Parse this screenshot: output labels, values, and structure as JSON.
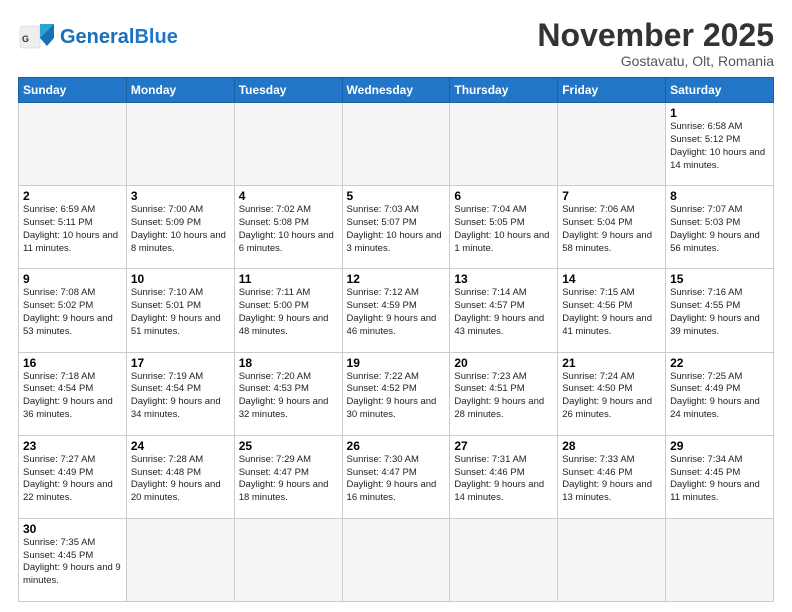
{
  "header": {
    "logo_general": "General",
    "logo_blue": "Blue",
    "month_title": "November 2025",
    "subtitle": "Gostavatu, Olt, Romania"
  },
  "weekdays": [
    "Sunday",
    "Monday",
    "Tuesday",
    "Wednesday",
    "Thursday",
    "Friday",
    "Saturday"
  ],
  "weeks": [
    [
      {
        "day": "",
        "info": "",
        "empty": true
      },
      {
        "day": "",
        "info": "",
        "empty": true
      },
      {
        "day": "",
        "info": "",
        "empty": true
      },
      {
        "day": "",
        "info": "",
        "empty": true
      },
      {
        "day": "",
        "info": "",
        "empty": true
      },
      {
        "day": "",
        "info": "",
        "empty": true
      },
      {
        "day": "1",
        "info": "Sunrise: 6:58 AM\nSunset: 5:12 PM\nDaylight: 10 hours\nand 14 minutes.",
        "empty": false
      }
    ],
    [
      {
        "day": "2",
        "info": "Sunrise: 6:59 AM\nSunset: 5:11 PM\nDaylight: 10 hours\nand 11 minutes.",
        "empty": false
      },
      {
        "day": "3",
        "info": "Sunrise: 7:00 AM\nSunset: 5:09 PM\nDaylight: 10 hours\nand 8 minutes.",
        "empty": false
      },
      {
        "day": "4",
        "info": "Sunrise: 7:02 AM\nSunset: 5:08 PM\nDaylight: 10 hours\nand 6 minutes.",
        "empty": false
      },
      {
        "day": "5",
        "info": "Sunrise: 7:03 AM\nSunset: 5:07 PM\nDaylight: 10 hours\nand 3 minutes.",
        "empty": false
      },
      {
        "day": "6",
        "info": "Sunrise: 7:04 AM\nSunset: 5:05 PM\nDaylight: 10 hours\nand 1 minute.",
        "empty": false
      },
      {
        "day": "7",
        "info": "Sunrise: 7:06 AM\nSunset: 5:04 PM\nDaylight: 9 hours\nand 58 minutes.",
        "empty": false
      },
      {
        "day": "8",
        "info": "Sunrise: 7:07 AM\nSunset: 5:03 PM\nDaylight: 9 hours\nand 56 minutes.",
        "empty": false
      }
    ],
    [
      {
        "day": "9",
        "info": "Sunrise: 7:08 AM\nSunset: 5:02 PM\nDaylight: 9 hours\nand 53 minutes.",
        "empty": false
      },
      {
        "day": "10",
        "info": "Sunrise: 7:10 AM\nSunset: 5:01 PM\nDaylight: 9 hours\nand 51 minutes.",
        "empty": false
      },
      {
        "day": "11",
        "info": "Sunrise: 7:11 AM\nSunset: 5:00 PM\nDaylight: 9 hours\nand 48 minutes.",
        "empty": false
      },
      {
        "day": "12",
        "info": "Sunrise: 7:12 AM\nSunset: 4:59 PM\nDaylight: 9 hours\nand 46 minutes.",
        "empty": false
      },
      {
        "day": "13",
        "info": "Sunrise: 7:14 AM\nSunset: 4:57 PM\nDaylight: 9 hours\nand 43 minutes.",
        "empty": false
      },
      {
        "day": "14",
        "info": "Sunrise: 7:15 AM\nSunset: 4:56 PM\nDaylight: 9 hours\nand 41 minutes.",
        "empty": false
      },
      {
        "day": "15",
        "info": "Sunrise: 7:16 AM\nSunset: 4:55 PM\nDaylight: 9 hours\nand 39 minutes.",
        "empty": false
      }
    ],
    [
      {
        "day": "16",
        "info": "Sunrise: 7:18 AM\nSunset: 4:54 PM\nDaylight: 9 hours\nand 36 minutes.",
        "empty": false
      },
      {
        "day": "17",
        "info": "Sunrise: 7:19 AM\nSunset: 4:54 PM\nDaylight: 9 hours\nand 34 minutes.",
        "empty": false
      },
      {
        "day": "18",
        "info": "Sunrise: 7:20 AM\nSunset: 4:53 PM\nDaylight: 9 hours\nand 32 minutes.",
        "empty": false
      },
      {
        "day": "19",
        "info": "Sunrise: 7:22 AM\nSunset: 4:52 PM\nDaylight: 9 hours\nand 30 minutes.",
        "empty": false
      },
      {
        "day": "20",
        "info": "Sunrise: 7:23 AM\nSunset: 4:51 PM\nDaylight: 9 hours\nand 28 minutes.",
        "empty": false
      },
      {
        "day": "21",
        "info": "Sunrise: 7:24 AM\nSunset: 4:50 PM\nDaylight: 9 hours\nand 26 minutes.",
        "empty": false
      },
      {
        "day": "22",
        "info": "Sunrise: 7:25 AM\nSunset: 4:49 PM\nDaylight: 9 hours\nand 24 minutes.",
        "empty": false
      }
    ],
    [
      {
        "day": "23",
        "info": "Sunrise: 7:27 AM\nSunset: 4:49 PM\nDaylight: 9 hours\nand 22 minutes.",
        "empty": false
      },
      {
        "day": "24",
        "info": "Sunrise: 7:28 AM\nSunset: 4:48 PM\nDaylight: 9 hours\nand 20 minutes.",
        "empty": false
      },
      {
        "day": "25",
        "info": "Sunrise: 7:29 AM\nSunset: 4:47 PM\nDaylight: 9 hours\nand 18 minutes.",
        "empty": false
      },
      {
        "day": "26",
        "info": "Sunrise: 7:30 AM\nSunset: 4:47 PM\nDaylight: 9 hours\nand 16 minutes.",
        "empty": false
      },
      {
        "day": "27",
        "info": "Sunrise: 7:31 AM\nSunset: 4:46 PM\nDaylight: 9 hours\nand 14 minutes.",
        "empty": false
      },
      {
        "day": "28",
        "info": "Sunrise: 7:33 AM\nSunset: 4:46 PM\nDaylight: 9 hours\nand 13 minutes.",
        "empty": false
      },
      {
        "day": "29",
        "info": "Sunrise: 7:34 AM\nSunset: 4:45 PM\nDaylight: 9 hours\nand 11 minutes.",
        "empty": false
      }
    ],
    [
      {
        "day": "30",
        "info": "Sunrise: 7:35 AM\nSunset: 4:45 PM\nDaylight: 9 hours\nand 9 minutes.",
        "empty": false
      },
      {
        "day": "",
        "info": "",
        "empty": true
      },
      {
        "day": "",
        "info": "",
        "empty": true
      },
      {
        "day": "",
        "info": "",
        "empty": true
      },
      {
        "day": "",
        "info": "",
        "empty": true
      },
      {
        "day": "",
        "info": "",
        "empty": true
      },
      {
        "day": "",
        "info": "",
        "empty": true
      }
    ]
  ]
}
